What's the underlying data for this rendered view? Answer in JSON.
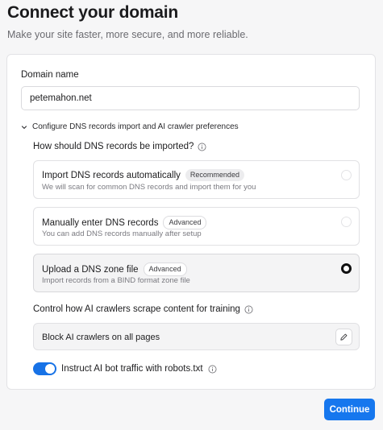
{
  "header": {
    "title": "Connect your domain",
    "subtitle": "Make your site faster, more secure, and more reliable."
  },
  "domain": {
    "label": "Domain name",
    "value": "petemahon.net"
  },
  "config_toggle": {
    "label": "Configure DNS records import and AI crawler preferences",
    "expanded": true
  },
  "dns_import": {
    "question": "How should DNS records be imported?",
    "selected_index": 2,
    "options": [
      {
        "title": "Import DNS records automatically",
        "badge": "Recommended",
        "description": "We will scan for common DNS records and import them for you"
      },
      {
        "title": "Manually enter DNS records",
        "badge": "Advanced",
        "description": "You can add DNS records manually after setup"
      },
      {
        "title": "Upload a DNS zone file",
        "badge": "Advanced",
        "description": "Import records from a BIND format zone file"
      }
    ]
  },
  "ai_crawlers": {
    "question": "Control how AI crawlers scrape content for training",
    "selection": "Block AI crawlers on all pages",
    "robots_label": "Instruct AI bot traffic with robots.txt",
    "robots_enabled": true
  },
  "actions": {
    "continue_label": "Continue"
  },
  "colors": {
    "accent": "#1677ee",
    "toggle_on": "#1772e6"
  }
}
